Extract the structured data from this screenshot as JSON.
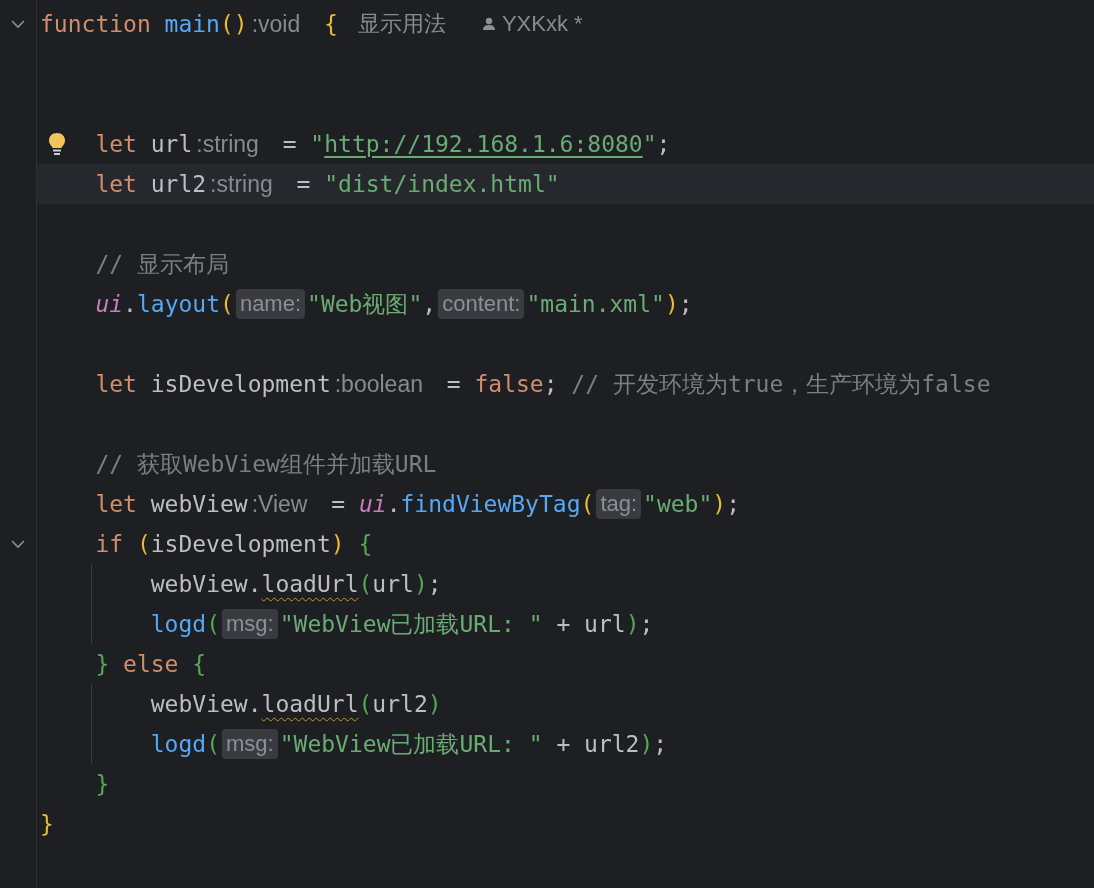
{
  "editor": {
    "lines": [
      {
        "fold": true,
        "tokens": [
          {
            "kind": "keyword",
            "text": "function"
          },
          {
            "kind": "function",
            "text": "main",
            "space": true
          },
          {
            "kind": "brace1",
            "text": "()"
          },
          {
            "kind": "type_hint",
            "text": ":void"
          },
          {
            "kind": "brace1",
            "text": "{",
            "space": true
          },
          {
            "kind": "usage_hint",
            "text": "显示用法"
          },
          {
            "kind": "author_hint",
            "text": "YXKxk *"
          }
        ],
        "children": [
          {
            "blank": true
          },
          {
            "blank": true
          },
          {
            "bulb": true,
            "tokens": [
              {
                "kind": "keyword",
                "text": "let"
              },
              {
                "kind": "plain",
                "text": "url",
                "space": true
              },
              {
                "kind": "type_hint",
                "text": ":string"
              },
              {
                "kind": "plain",
                "text": "=",
                "space": true
              },
              {
                "kind": "string",
                "text": "\"",
                "space": true
              },
              {
                "kind": "url",
                "text": "http://192.168.1.6:8080"
              },
              {
                "kind": "string",
                "text": "\""
              },
              {
                "kind": "plain",
                "text": ";"
              }
            ]
          },
          {
            "current": true,
            "tokens": [
              {
                "kind": "keyword",
                "text": "let"
              },
              {
                "kind": "plain",
                "text": "url2",
                "space": true
              },
              {
                "kind": "type_hint",
                "text": ":string"
              },
              {
                "kind": "plain",
                "text": "=",
                "space": true
              },
              {
                "kind": "string",
                "text": "\"dist/index.html\"",
                "space": true
              }
            ]
          },
          {
            "blank": true
          },
          {
            "tokens": [
              {
                "kind": "comment",
                "text": "// 显示布局"
              }
            ]
          },
          {
            "tokens": [
              {
                "kind": "object",
                "text": "ui"
              },
              {
                "kind": "plain",
                "text": "."
              },
              {
                "kind": "function",
                "text": "layout"
              },
              {
                "kind": "brace1",
                "text": "("
              },
              {
                "kind": "param_hint",
                "text": "name:"
              },
              {
                "kind": "string",
                "text": "\"Web视图\""
              },
              {
                "kind": "plain",
                "text": ","
              },
              {
                "kind": "param_hint",
                "text": "content:",
                "space": true
              },
              {
                "kind": "string",
                "text": "\"main.xml\""
              },
              {
                "kind": "brace1",
                "text": ")"
              },
              {
                "kind": "plain",
                "text": ";"
              }
            ]
          },
          {
            "blank": true
          },
          {
            "tokens": [
              {
                "kind": "keyword",
                "text": "let"
              },
              {
                "kind": "plain",
                "text": "isDevelopment",
                "space": true
              },
              {
                "kind": "type_hint",
                "text": ":boolean"
              },
              {
                "kind": "plain",
                "text": "=",
                "space": true
              },
              {
                "kind": "keyword",
                "text": "false",
                "space": true
              },
              {
                "kind": "plain",
                "text": ";"
              },
              {
                "kind": "comment",
                "text": "// 开发环境为true，生产环境为false",
                "space": true
              }
            ]
          },
          {
            "blank": true
          },
          {
            "tokens": [
              {
                "kind": "comment",
                "text": "// 获取WebView组件并加载URL"
              }
            ]
          },
          {
            "tokens": [
              {
                "kind": "keyword",
                "text": "let"
              },
              {
                "kind": "plain",
                "text": "webView",
                "space": true
              },
              {
                "kind": "type_hint",
                "text": ":View"
              },
              {
                "kind": "plain",
                "text": "=",
                "space": true
              },
              {
                "kind": "object",
                "text": "ui",
                "space": true
              },
              {
                "kind": "plain",
                "text": "."
              },
              {
                "kind": "function",
                "text": "findViewByTag"
              },
              {
                "kind": "brace1",
                "text": "("
              },
              {
                "kind": "param_hint",
                "text": "tag:"
              },
              {
                "kind": "string",
                "text": "\"web\""
              },
              {
                "kind": "brace1",
                "text": ")"
              },
              {
                "kind": "plain",
                "text": ";"
              }
            ]
          },
          {
            "fold": true,
            "guide": true,
            "tokens": [
              {
                "kind": "keyword",
                "text": "if"
              },
              {
                "kind": "brace1",
                "text": "(",
                "space": true
              },
              {
                "kind": "plain",
                "text": "isDevelopment"
              },
              {
                "kind": "brace1",
                "text": ")"
              },
              {
                "kind": "brace2",
                "text": "{",
                "space": true
              }
            ],
            "children": [
              {
                "tokens": [
                  {
                    "kind": "plain",
                    "text": "webView."
                  },
                  {
                    "kind": "warning",
                    "text": "loadUrl"
                  },
                  {
                    "kind": "brace2",
                    "text": "("
                  },
                  {
                    "kind": "plain",
                    "text": "url"
                  },
                  {
                    "kind": "brace2",
                    "text": ")"
                  },
                  {
                    "kind": "plain",
                    "text": ";"
                  }
                ]
              },
              {
                "tokens": [
                  {
                    "kind": "function",
                    "text": "logd"
                  },
                  {
                    "kind": "brace2",
                    "text": "("
                  },
                  {
                    "kind": "param_hint",
                    "text": "msg:"
                  },
                  {
                    "kind": "string",
                    "text": "\"WebView已加载URL: \""
                  },
                  {
                    "kind": "plain",
                    "text": "+ url",
                    "space": true
                  },
                  {
                    "kind": "brace2",
                    "text": ")"
                  },
                  {
                    "kind": "plain",
                    "text": ";"
                  }
                ]
              }
            ]
          },
          {
            "guide": true,
            "tokens": [
              {
                "kind": "brace2",
                "text": "}"
              },
              {
                "kind": "keyword",
                "text": "else",
                "space": true
              },
              {
                "kind": "brace2",
                "text": "{",
                "space": true
              }
            ],
            "children": [
              {
                "tokens": [
                  {
                    "kind": "plain",
                    "text": "webView."
                  },
                  {
                    "kind": "warning",
                    "text": "loadUrl"
                  },
                  {
                    "kind": "brace2",
                    "text": "("
                  },
                  {
                    "kind": "plain",
                    "text": "url2"
                  },
                  {
                    "kind": "brace2",
                    "text": ")"
                  }
                ]
              },
              {
                "tokens": [
                  {
                    "kind": "function",
                    "text": "logd"
                  },
                  {
                    "kind": "brace2",
                    "text": "("
                  },
                  {
                    "kind": "param_hint",
                    "text": "msg:"
                  },
                  {
                    "kind": "string",
                    "text": "\"WebView已加载URL: \""
                  },
                  {
                    "kind": "plain",
                    "text": "+ url2",
                    "space": true
                  },
                  {
                    "kind": "brace2",
                    "text": ")"
                  },
                  {
                    "kind": "plain",
                    "text": ";"
                  }
                ]
              }
            ]
          },
          {
            "tokens": [
              {
                "kind": "brace2",
                "text": "}"
              }
            ]
          }
        ]
      },
      {
        "tokens": [
          {
            "kind": "brace1",
            "text": "}"
          }
        ]
      }
    ]
  }
}
